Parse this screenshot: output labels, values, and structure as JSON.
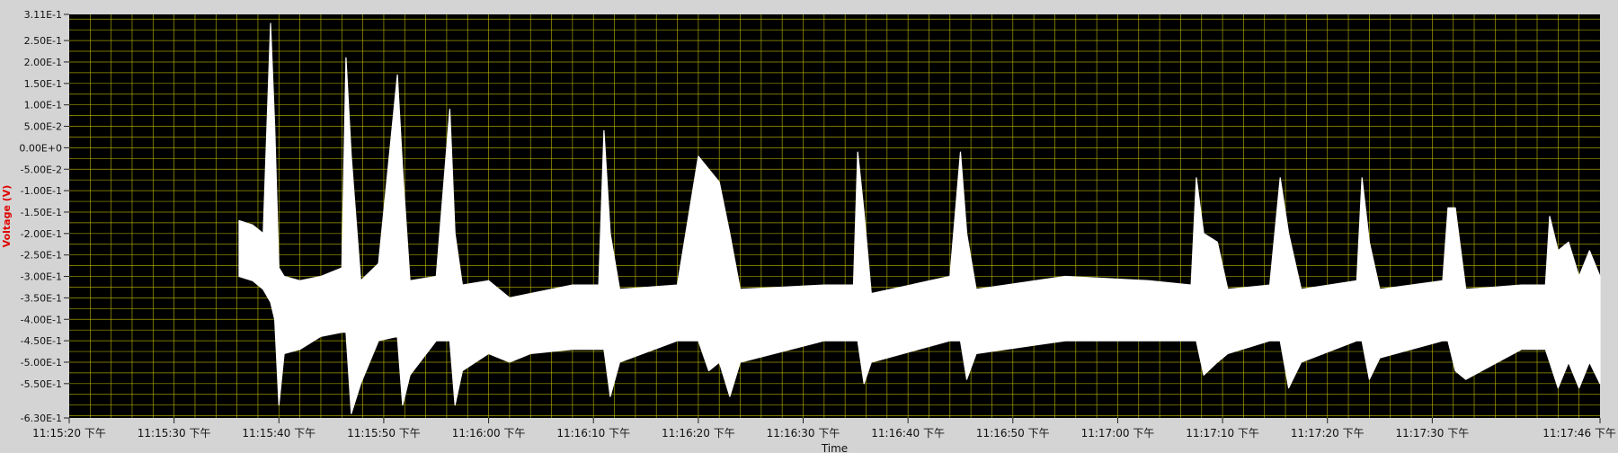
{
  "chart_data": {
    "type": "line",
    "title": "",
    "xlabel": "Time",
    "ylabel": "Voltage (V)",
    "grid": true,
    "colors": {
      "plot_background": "#000000",
      "grid": "#c8c400",
      "series": "#ffffff",
      "ylabel": "#e00000",
      "frame": "#d4d4d4"
    },
    "y_axis": {
      "min": -0.63,
      "max": 0.311,
      "ticks": [
        {
          "value": 0.311,
          "label": "3.11E-1"
        },
        {
          "value": 0.25,
          "label": "2.50E-1"
        },
        {
          "value": 0.2,
          "label": "2.00E-1"
        },
        {
          "value": 0.15,
          "label": "1.50E-1"
        },
        {
          "value": 0.1,
          "label": "1.00E-1"
        },
        {
          "value": 0.05,
          "label": "5.00E-2"
        },
        {
          "value": 0.0,
          "label": "0.00E+0"
        },
        {
          "value": -0.05,
          "label": "-5.00E-2"
        },
        {
          "value": -0.1,
          "label": "-1.00E-1"
        },
        {
          "value": -0.15,
          "label": "-1.50E-1"
        },
        {
          "value": -0.2,
          "label": "-2.00E-1"
        },
        {
          "value": -0.25,
          "label": "-2.50E-1"
        },
        {
          "value": -0.3,
          "label": "-3.00E-1"
        },
        {
          "value": -0.35,
          "label": "-3.50E-1"
        },
        {
          "value": -0.4,
          "label": "-4.00E-1"
        },
        {
          "value": -0.45,
          "label": "-4.50E-1"
        },
        {
          "value": -0.5,
          "label": "-5.00E-1"
        },
        {
          "value": -0.55,
          "label": "-5.50E-1"
        },
        {
          "value": -0.63,
          "label": "-6.30E-1"
        }
      ]
    },
    "x_axis": {
      "start": "11:15:20 下午",
      "end": "11:17:46 下午",
      "min_seconds": 0,
      "max_seconds": 146,
      "ticks": [
        {
          "value": 0,
          "label": "11:15:20 下午"
        },
        {
          "value": 10,
          "label": "11:15:30 下午"
        },
        {
          "value": 20,
          "label": "11:15:40 下午"
        },
        {
          "value": 30,
          "label": "11:15:50 下午"
        },
        {
          "value": 40,
          "label": "11:16:00 下午"
        },
        {
          "value": 50,
          "label": "11:16:10 下午"
        },
        {
          "value": 60,
          "label": "11:16:20 下午"
        },
        {
          "value": 70,
          "label": "11:16:30 下午"
        },
        {
          "value": 80,
          "label": "11:16:40 下午"
        },
        {
          "value": 90,
          "label": "11:16:50 下午"
        },
        {
          "value": 100,
          "label": "11:17:00 下午"
        },
        {
          "value": 110,
          "label": "11:17:10 下午"
        },
        {
          "value": 120,
          "label": "11:17:20 下午"
        },
        {
          "value": 130,
          "label": "11:17:30 下午"
        },
        {
          "value": 146,
          "label": "11:17:46 下午"
        }
      ]
    },
    "series": [
      {
        "envelope": [
          {
            "t": 16.2,
            "upper": -0.17,
            "lower": -0.3
          },
          {
            "t": 17.5,
            "upper": -0.18,
            "lower": -0.31
          },
          {
            "t": 18.5,
            "upper": -0.2,
            "lower": -0.33
          },
          {
            "t": 19.2,
            "upper": 0.29,
            "lower": -0.36
          },
          {
            "t": 19.6,
            "upper": 0.05,
            "lower": -0.4
          },
          {
            "t": 20.0,
            "upper": -0.28,
            "lower": -0.6
          },
          {
            "t": 20.5,
            "upper": -0.3,
            "lower": -0.48
          },
          {
            "t": 22.0,
            "upper": -0.31,
            "lower": -0.47
          },
          {
            "t": 24.0,
            "upper": -0.3,
            "lower": -0.44
          },
          {
            "t": 26.0,
            "upper": -0.28,
            "lower": -0.43
          },
          {
            "t": 26.4,
            "upper": 0.21,
            "lower": -0.43
          },
          {
            "t": 26.9,
            "upper": -0.02,
            "lower": -0.62
          },
          {
            "t": 27.8,
            "upper": -0.31,
            "lower": -0.55
          },
          {
            "t": 29.5,
            "upper": -0.27,
            "lower": -0.45
          },
          {
            "t": 31.3,
            "upper": 0.17,
            "lower": -0.44
          },
          {
            "t": 31.8,
            "upper": -0.05,
            "lower": -0.6
          },
          {
            "t": 32.5,
            "upper": -0.31,
            "lower": -0.53
          },
          {
            "t": 35.0,
            "upper": -0.3,
            "lower": -0.45
          },
          {
            "t": 36.3,
            "upper": 0.09,
            "lower": -0.45
          },
          {
            "t": 36.8,
            "upper": -0.2,
            "lower": -0.6
          },
          {
            "t": 37.5,
            "upper": -0.32,
            "lower": -0.52
          },
          {
            "t": 40.0,
            "upper": -0.31,
            "lower": -0.48
          },
          {
            "t": 42.0,
            "upper": -0.35,
            "lower": -0.5
          },
          {
            "t": 44.0,
            "upper": -0.34,
            "lower": -0.48
          },
          {
            "t": 48.0,
            "upper": -0.32,
            "lower": -0.47
          },
          {
            "t": 50.5,
            "upper": -0.32,
            "lower": -0.47
          },
          {
            "t": 51.0,
            "upper": 0.04,
            "lower": -0.47
          },
          {
            "t": 51.6,
            "upper": -0.2,
            "lower": -0.58
          },
          {
            "t": 52.5,
            "upper": -0.33,
            "lower": -0.5
          },
          {
            "t": 58.0,
            "upper": -0.32,
            "lower": -0.45
          },
          {
            "t": 60.0,
            "upper": -0.02,
            "lower": -0.45
          },
          {
            "t": 61.0,
            "upper": -0.05,
            "lower": -0.52
          },
          {
            "t": 62.0,
            "upper": -0.08,
            "lower": -0.5
          },
          {
            "t": 63.0,
            "upper": -0.2,
            "lower": -0.58
          },
          {
            "t": 64.0,
            "upper": -0.33,
            "lower": -0.5
          },
          {
            "t": 72.0,
            "upper": -0.32,
            "lower": -0.45
          },
          {
            "t": 74.8,
            "upper": -0.32,
            "lower": -0.45
          },
          {
            "t": 75.2,
            "upper": -0.01,
            "lower": -0.45
          },
          {
            "t": 75.8,
            "upper": -0.15,
            "lower": -0.55
          },
          {
            "t": 76.5,
            "upper": -0.34,
            "lower": -0.5
          },
          {
            "t": 84.0,
            "upper": -0.3,
            "lower": -0.45
          },
          {
            "t": 85.0,
            "upper": -0.01,
            "lower": -0.45
          },
          {
            "t": 85.6,
            "upper": -0.2,
            "lower": -0.54
          },
          {
            "t": 86.5,
            "upper": -0.33,
            "lower": -0.48
          },
          {
            "t": 95.0,
            "upper": -0.3,
            "lower": -0.45
          },
          {
            "t": 103.0,
            "upper": -0.31,
            "lower": -0.45
          },
          {
            "t": 107.0,
            "upper": -0.32,
            "lower": -0.45
          },
          {
            "t": 107.5,
            "upper": -0.07,
            "lower": -0.45
          },
          {
            "t": 108.2,
            "upper": -0.2,
            "lower": -0.53
          },
          {
            "t": 109.5,
            "upper": -0.22,
            "lower": -0.5
          },
          {
            "t": 110.5,
            "upper": -0.33,
            "lower": -0.48
          },
          {
            "t": 114.5,
            "upper": -0.32,
            "lower": -0.45
          },
          {
            "t": 115.5,
            "upper": -0.07,
            "lower": -0.45
          },
          {
            "t": 116.3,
            "upper": -0.2,
            "lower": -0.56
          },
          {
            "t": 117.5,
            "upper": -0.33,
            "lower": -0.5
          },
          {
            "t": 122.8,
            "upper": -0.31,
            "lower": -0.45
          },
          {
            "t": 123.3,
            "upper": -0.07,
            "lower": -0.45
          },
          {
            "t": 124.0,
            "upper": -0.22,
            "lower": -0.54
          },
          {
            "t": 125.0,
            "upper": -0.33,
            "lower": -0.49
          },
          {
            "t": 131.0,
            "upper": -0.31,
            "lower": -0.45
          },
          {
            "t": 131.5,
            "upper": -0.14,
            "lower": -0.45
          },
          {
            "t": 132.2,
            "upper": -0.14,
            "lower": -0.52
          },
          {
            "t": 133.2,
            "upper": -0.33,
            "lower": -0.54
          },
          {
            "t": 138.5,
            "upper": -0.32,
            "lower": -0.47
          },
          {
            "t": 140.8,
            "upper": -0.32,
            "lower": -0.47
          },
          {
            "t": 141.2,
            "upper": -0.16,
            "lower": -0.5
          },
          {
            "t": 142.0,
            "upper": -0.24,
            "lower": -0.56
          },
          {
            "t": 143.0,
            "upper": -0.22,
            "lower": -0.5
          },
          {
            "t": 144.0,
            "upper": -0.3,
            "lower": -0.56
          },
          {
            "t": 145.0,
            "upper": -0.24,
            "lower": -0.5
          },
          {
            "t": 146.0,
            "upper": -0.3,
            "lower": -0.55
          }
        ]
      }
    ]
  }
}
